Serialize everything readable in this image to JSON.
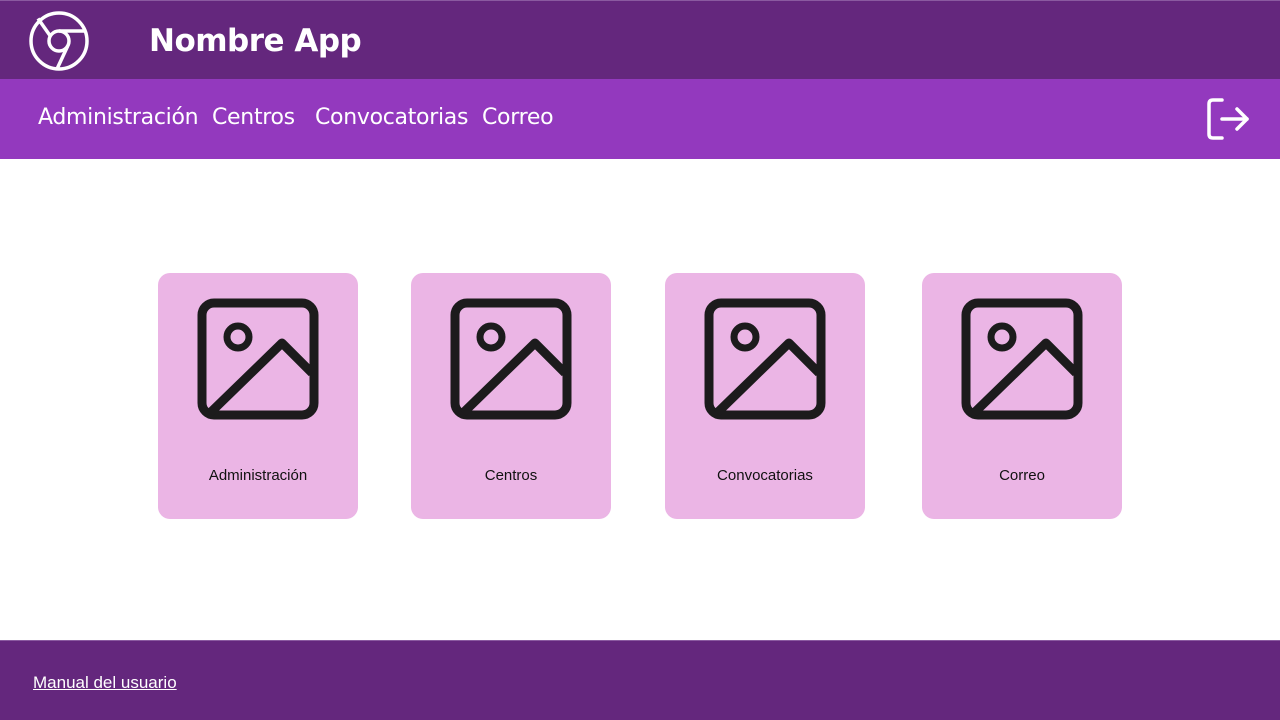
{
  "header": {
    "logo_icon": "browser-logo-icon",
    "title": "Nombre App"
  },
  "nav": {
    "items": [
      {
        "label": "Administración"
      },
      {
        "label": "Centros"
      },
      {
        "label": "Convocatorias"
      },
      {
        "label": "Correo"
      }
    ],
    "logout_icon": "logout-icon"
  },
  "cards": [
    {
      "label": "Administración",
      "icon": "image-placeholder-icon"
    },
    {
      "label": "Centros",
      "icon": "image-placeholder-icon"
    },
    {
      "label": "Convocatorias",
      "icon": "image-placeholder-icon"
    },
    {
      "label": "Correo",
      "icon": "image-placeholder-icon"
    }
  ],
  "footer": {
    "manual_link": "Manual del usuario"
  },
  "colors": {
    "header_bg": "#64277d",
    "nav_bg": "#9339be",
    "card_bg": "#ebb5e5",
    "footer_bg": "#64277d"
  }
}
